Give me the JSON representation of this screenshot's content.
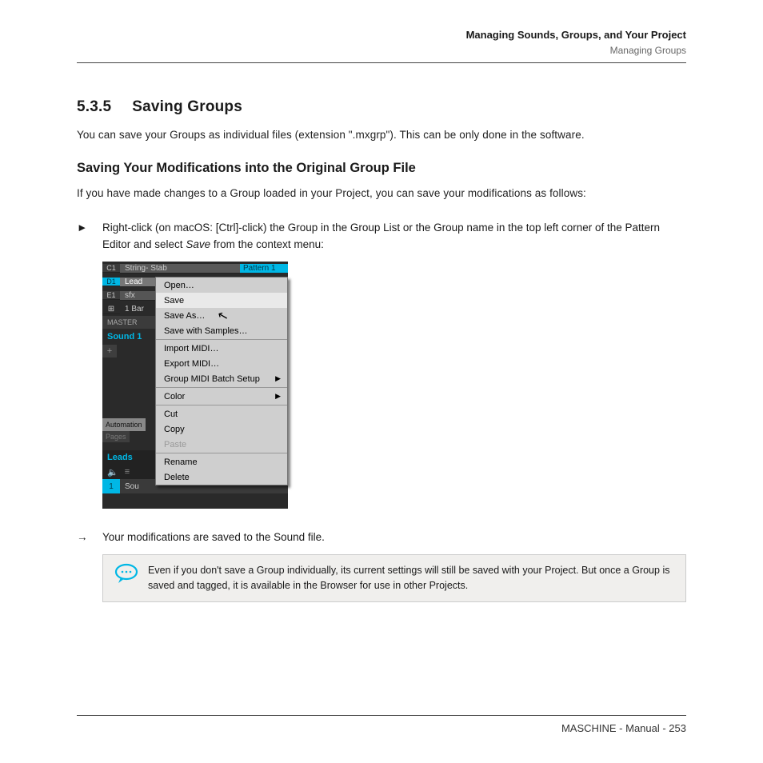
{
  "header": {
    "chapter": "Managing Sounds, Groups, and Your Project",
    "section": "Managing Groups"
  },
  "heading": {
    "number": "5.3.5",
    "title": "Saving Groups"
  },
  "intro": "You can save your Groups as individual files (extension \".mxgrp\"). This can be only done in the software.",
  "subheading": "Saving Your Modifications into the Original Group File",
  "para2": "If you have made changes to a Group loaded in your Project, you can save your modifications as follows:",
  "step": {
    "bullet": "►",
    "text_a": "Right-click (on macOS: [Ctrl]-click) the Group in the Group List or the Group name in the top left corner of the Pattern Editor and select ",
    "text_em": "Save",
    "text_b": " from the context menu:"
  },
  "shot": {
    "rows": [
      {
        "id": "C1",
        "name": "String- Stab",
        "pattern": "Pattern 1"
      },
      {
        "id": "D1",
        "name": "Lead"
      },
      {
        "id": "E1",
        "name": "sfx"
      }
    ],
    "grid_icon": "⊞",
    "bar_label": "1 Bar",
    "master": "MASTER",
    "sound1": "Sound 1",
    "plus": "+",
    "automation_tab": "Automation",
    "pages_tab": "Pages",
    "leads": "Leads",
    "speaker": "🔈",
    "menu_dots": "≡",
    "bottom_num": "1",
    "bottom_label": "Sou",
    "menu": [
      {
        "label": "Open…"
      },
      {
        "label": "Save",
        "highlight": true
      },
      {
        "label": "Save As…"
      },
      {
        "label": "Save with Samples…"
      },
      {
        "sep": true
      },
      {
        "label": "Import MIDI…"
      },
      {
        "label": "Export MIDI…"
      },
      {
        "label": "Group MIDI Batch Setup",
        "submenu": true
      },
      {
        "sep": true
      },
      {
        "label": "Color",
        "submenu": true
      },
      {
        "sep": true
      },
      {
        "label": "Cut"
      },
      {
        "label": "Copy"
      },
      {
        "label": "Paste",
        "disabled": true
      },
      {
        "sep": true
      },
      {
        "label": "Rename"
      },
      {
        "label": "Delete"
      }
    ]
  },
  "result": {
    "arrow": "→",
    "text": "Your modifications are saved to the Sound file."
  },
  "tip": "Even if you don't save a Group individually, its current settings will still be saved with your Project. But once a Group is saved and tagged, it is available in the Browser for use in other Projects.",
  "footer": "MASCHINE - Manual - 253"
}
